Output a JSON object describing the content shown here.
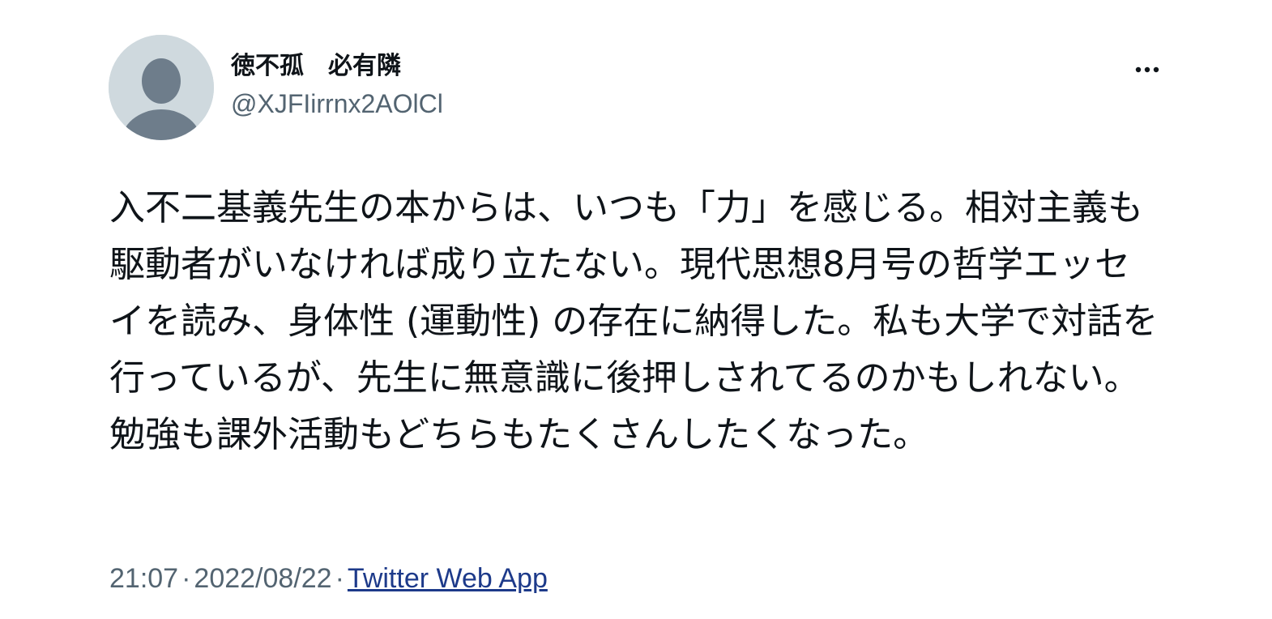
{
  "user": {
    "display_name": "徳不孤　必有隣",
    "handle": "@XJFIirrnx2AOlCl",
    "avatar_icon": "default-profile-silhouette-icon"
  },
  "menu": {
    "more_icon": "more-horizontal-icon"
  },
  "tweet": {
    "text": "入不二基義先生の本からは、いつも「力」を感じる。相対主義も駆動者がいなければ成り立たない。現代思想8月号の哲学エッセイを読み、身体性 (運動性) の存在に納得した。私も大学で対話を行っているが、先生に無意識に後押しされてるのかもしれない。勉強も課外活動もどちらもたくさんしたくなった。"
  },
  "meta": {
    "time": "21:07",
    "date": "2022/08/22",
    "separator": "·",
    "source": "Twitter Web App"
  },
  "colors": {
    "text_primary": "#0f1419",
    "text_secondary": "#536471",
    "link": "#1d3a8a",
    "avatar_bg": "#cfd9de",
    "avatar_figure": "#6e7d8b"
  }
}
